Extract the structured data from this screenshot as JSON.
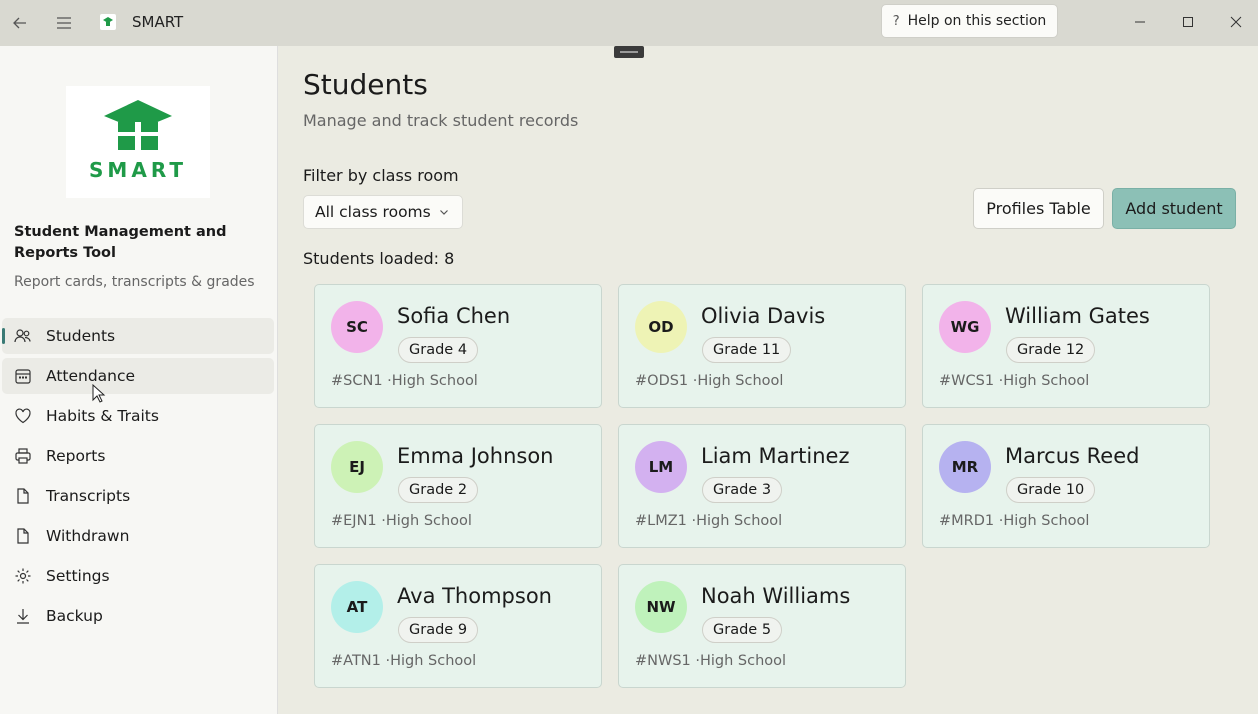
{
  "titlebar": {
    "app_title": "SMART",
    "help_label": "Help on this section",
    "help_icon": "?"
  },
  "sidebar": {
    "logo_text": "SMART",
    "app_name": "Student Management and Reports Tool",
    "app_subtitle": "Report cards, transcripts & grades",
    "items": [
      {
        "label": "Students",
        "icon": "people-icon",
        "state": "active"
      },
      {
        "label": "Attendance",
        "icon": "calendar-icon",
        "state": "hover"
      },
      {
        "label": "Habits & Traits",
        "icon": "heart-icon",
        "state": ""
      },
      {
        "label": "Reports",
        "icon": "printer-icon",
        "state": ""
      },
      {
        "label": "Transcripts",
        "icon": "document-icon",
        "state": ""
      },
      {
        "label": "Withdrawn",
        "icon": "document-icon",
        "state": ""
      },
      {
        "label": "Settings",
        "icon": "gear-icon",
        "state": ""
      },
      {
        "label": "Backup",
        "icon": "download-icon",
        "state": ""
      }
    ]
  },
  "main": {
    "title": "Students",
    "subtitle": "Manage and track student records",
    "filter_label": "Filter by class room",
    "filter_value": "All class rooms",
    "profiles_button": "Profiles Table",
    "add_button": "Add student",
    "loaded_text": "Students loaded: 8"
  },
  "students": [
    {
      "initials": "SC",
      "name": "Sofia Chen",
      "grade": "Grade 4",
      "meta": "#SCN1 ·High School",
      "color": "#f2b3ea"
    },
    {
      "initials": "OD",
      "name": "Olivia Davis",
      "grade": "Grade 11",
      "meta": "#ODS1 ·High School",
      "color": "#eef3b5"
    },
    {
      "initials": "WG",
      "name": "William Gates",
      "grade": "Grade 12",
      "meta": "#WCS1 ·High School",
      "color": "#f2b3ea"
    },
    {
      "initials": "EJ",
      "name": "Emma Johnson",
      "grade": "Grade 2",
      "meta": "#EJN1 ·High School",
      "color": "#cdf2b6"
    },
    {
      "initials": "LM",
      "name": "Liam Martinez",
      "grade": "Grade 3",
      "meta": "#LMZ1 ·High School",
      "color": "#d3b1f0"
    },
    {
      "initials": "MR",
      "name": "Marcus Reed",
      "grade": "Grade 10",
      "meta": "#MRD1 ·High School",
      "color": "#b6b2f0"
    },
    {
      "initials": "AT",
      "name": "Ava Thompson",
      "grade": "Grade 9",
      "meta": "#ATN1 ·High School",
      "color": "#b3efe9"
    },
    {
      "initials": "NW",
      "name": "Noah Williams",
      "grade": "Grade 5",
      "meta": "#NWS1 ·High School",
      "color": "#bff2bb"
    }
  ]
}
